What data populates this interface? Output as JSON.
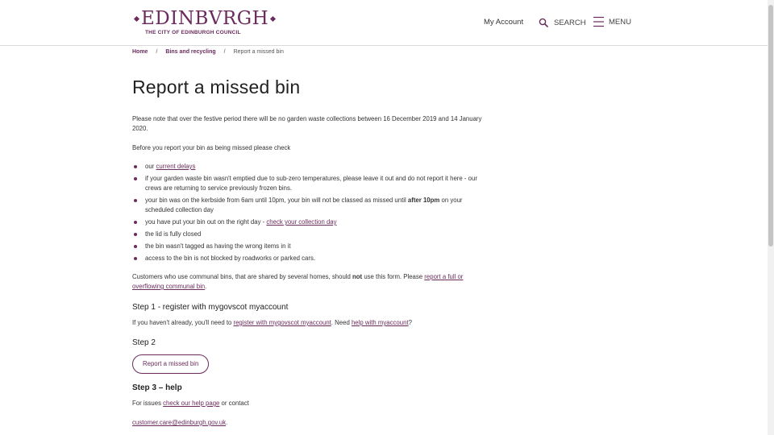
{
  "header": {
    "logo_main": "EDINBVRGH",
    "logo_sub": "THE CITY OF EDINBURGH COUNCIL",
    "my_account": "My Account",
    "search_label": "SEARCH",
    "menu_label": "MENU"
  },
  "breadcrumb": {
    "home": "Home",
    "section": "Bins and recycling",
    "current": "Report a missed bin",
    "separator": "/"
  },
  "page": {
    "title": "Report a missed bin",
    "festive_note": "Please note that over the festive period there will be no garden waste collections between 16 December 2019 and 14 January 2020.",
    "before_check": "Before you report your bin as being missed please check",
    "checks": {
      "c1_pre": "our ",
      "c1_link": "current delays",
      "c2": "if your garden waste bin wasn't emptied due to sub-zero temperatures, please leave it out and do not report it here - our crews are returning to service previously frozen bins.",
      "c3_pre": "your bin was on the kerbside from 6am until 10pm, your bin will not be classed as missed until ",
      "c3_bold": "after 10pm",
      "c3_post": " on your scheduled collection day",
      "c4_pre": "you have put your bin out on the right day - ",
      "c4_link": "check your collection day",
      "c5": "the lid is fully closed",
      "c6": "the bin wasn't tagged as having the wrong items in it",
      "c7": "access to the bin is not blocked by roadworks or parked cars."
    },
    "communal": {
      "pre": "Customers who use communal bins, that are shared by several homes, should ",
      "bold": "not",
      "mid": " use this form. Please ",
      "link": "report a full or overflowing communal bin",
      "post": "."
    },
    "step1": {
      "heading": "Step 1 - register with mygovscot myaccount",
      "pre": "If you haven't already, you'll need to ",
      "link1": "register with mygovscot myaccount",
      "mid": ". Need ",
      "link2": "help with myaccount",
      "post": "?"
    },
    "step2": {
      "heading": "Step 2",
      "button": "Report a missed bin"
    },
    "step3": {
      "heading": "Step 3 – help",
      "pre": "For issues ",
      "link": "check our help page",
      "post": " or contact",
      "email": "customer.care@edinburgh.gov.uk",
      "email_post": "."
    }
  },
  "colors": {
    "brand": "#6a2c5d",
    "text": "#333333"
  }
}
